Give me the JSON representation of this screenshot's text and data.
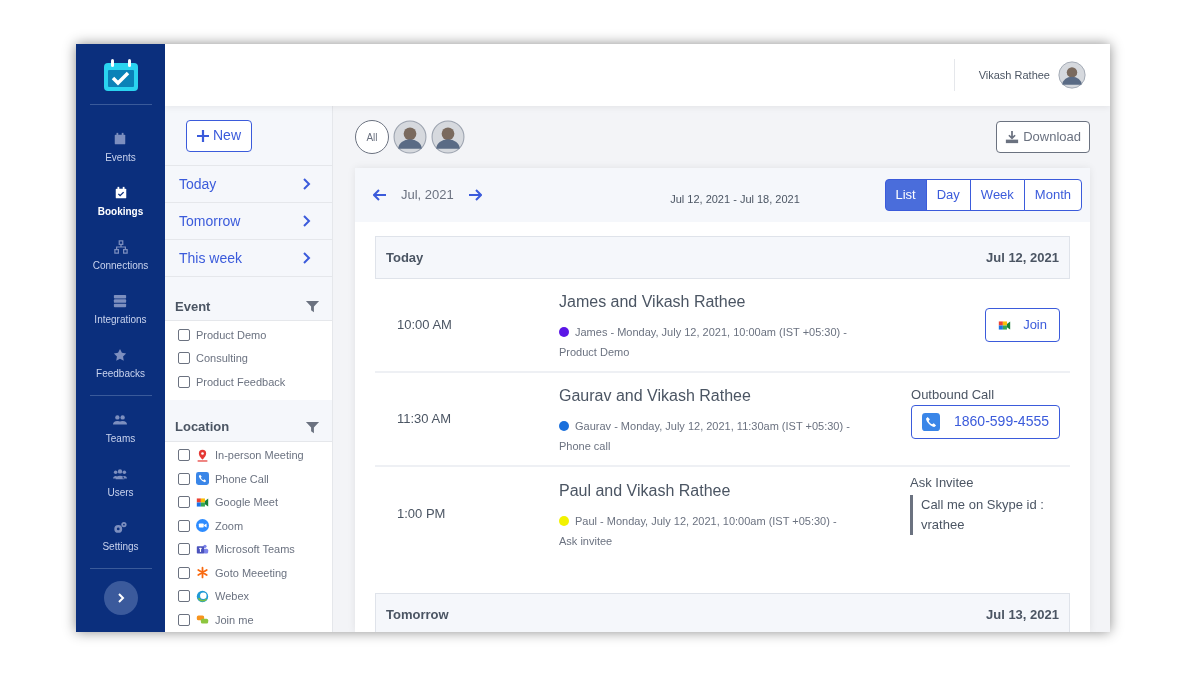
{
  "sidebar": {
    "items": [
      {
        "label": "Events",
        "kind": "calendar",
        "selected": false
      },
      {
        "label": "Bookings",
        "kind": "booking",
        "selected": true
      },
      {
        "label": "Connections",
        "kind": "network",
        "selected": false
      },
      {
        "label": "Integrations",
        "kind": "server",
        "selected": false
      },
      {
        "label": "Feedbacks",
        "kind": "star",
        "selected": false
      },
      {
        "label": "Teams",
        "kind": "team",
        "selected": false
      },
      {
        "label": "Users",
        "kind": "users",
        "selected": false
      },
      {
        "label": "Settings",
        "kind": "gear",
        "selected": false
      }
    ]
  },
  "header": {
    "user_name": "Vikash Rathee"
  },
  "new_button": "New",
  "quick_filters": [
    {
      "label": "Today"
    },
    {
      "label": "Tomorrow"
    },
    {
      "label": "This week"
    }
  ],
  "event_filter": {
    "title": "Event",
    "items": [
      {
        "label": "Product Demo",
        "checked": false
      },
      {
        "label": "Consulting",
        "checked": false
      },
      {
        "label": "Product Feedback",
        "checked": false
      }
    ]
  },
  "location_filter": {
    "title": "Location",
    "items": [
      {
        "label": "In-person Meeting",
        "kind": "pin",
        "checked": false
      },
      {
        "label": "Phone Call",
        "kind": "phone",
        "checked": false
      },
      {
        "label": "Google Meet",
        "kind": "meet",
        "checked": false
      },
      {
        "label": "Zoom",
        "kind": "zoom",
        "checked": false
      },
      {
        "label": "Microsoft Teams",
        "kind": "teams",
        "checked": false
      },
      {
        "label": "Goto Meeeting",
        "kind": "goto",
        "checked": false
      },
      {
        "label": "Webex",
        "kind": "webex",
        "checked": false
      },
      {
        "label": "Join me",
        "kind": "joinme",
        "checked": false
      }
    ]
  },
  "people_filter": {
    "all_label": "All",
    "selected_all": true
  },
  "download_button": "Download",
  "calendar": {
    "month": "Jul, 2021",
    "range": "Jul 12, 2021 - Jul 18, 2021",
    "views": [
      {
        "label": "List",
        "selected": true
      },
      {
        "label": "Day",
        "selected": false
      },
      {
        "label": "Week",
        "selected": false
      },
      {
        "label": "Month",
        "selected": false
      }
    ]
  },
  "days": [
    {
      "label": "Today",
      "date": "Jul 12, 2021",
      "bookings": [
        {
          "time": "10:00 AM",
          "title": "James and Vikash Rathee",
          "color": "#5b16e6",
          "details": "James - Monday, July 12, 2021, 10:00am (IST +05:30) -",
          "event": "Product Demo",
          "location": {
            "kind": "join",
            "button": "Join"
          }
        },
        {
          "time": "11:30 AM",
          "title": "Gaurav and Vikash Rathee",
          "color": "#1a6fdc",
          "details": "Gaurav - Monday, July 12, 2021, 11:30am (IST +05:30) -",
          "event": "Phone call",
          "location": {
            "kind": "phone",
            "label": "Outbound Call",
            "button": "1860-599-4555"
          }
        },
        {
          "time": "1:00 PM",
          "title": "Paul and Vikash Rathee",
          "color": "#f2f200",
          "details": "Paul - Monday, July 12, 2021, 10:00am (IST +05:30) -",
          "event": "Ask invitee",
          "location": {
            "kind": "note",
            "label": "Ask Invitee",
            "note": "Call me on Skype id : vrathee"
          }
        }
      ]
    },
    {
      "label": "Tomorrow",
      "date": "Jul 13, 2021"
    }
  ]
}
